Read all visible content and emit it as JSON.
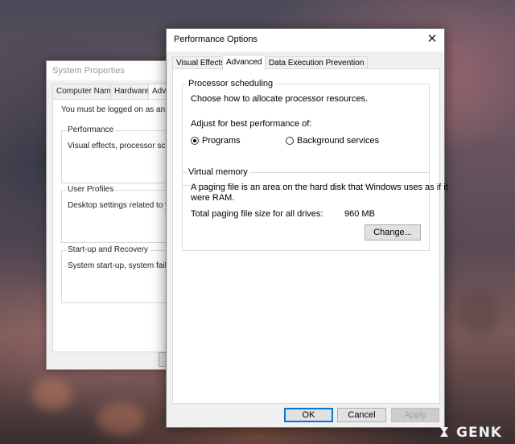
{
  "system_properties": {
    "title": "System Properties",
    "tabs": [
      "Computer Name",
      "Hardware",
      "Adva"
    ],
    "logged_on_note": "You must be logged on as an Adm",
    "groups": [
      {
        "legend": "Performance",
        "description": "Visual effects, processor schedu"
      },
      {
        "legend": "User Profiles",
        "description": "Desktop settings related to your"
      },
      {
        "legend": "Start-up and Recovery",
        "description": "System start-up, system failure a"
      }
    ]
  },
  "performance_options": {
    "title": "Performance Options",
    "close_glyph": "✕",
    "tabs": {
      "visual_effects": "Visual Effects",
      "advanced": "Advanced",
      "dep": "Data Execution Prevention"
    },
    "processor_scheduling": {
      "legend": "Processor scheduling",
      "description": "Choose how to allocate processor resources.",
      "adjust_label": "Adjust for best performance of:",
      "options": [
        {
          "label": "Programs",
          "selected": true
        },
        {
          "label": "Background services",
          "selected": false
        }
      ]
    },
    "virtual_memory": {
      "legend": "Virtual memory",
      "description_line1": "A paging file is an area on the hard disk that Windows uses as if it",
      "description_line2": "were RAM.",
      "total_label": "Total paging file size for all drives:",
      "total_value": "960 MB",
      "change_label": "Change..."
    },
    "buttons": {
      "ok": "OK",
      "cancel": "Cancel",
      "apply": "Apply"
    }
  },
  "watermark": {
    "text": "GENK"
  },
  "colors": {
    "accent": "#0078d7",
    "dialog_bg": "#f0f0f0",
    "panel_bg": "#ffffff"
  }
}
